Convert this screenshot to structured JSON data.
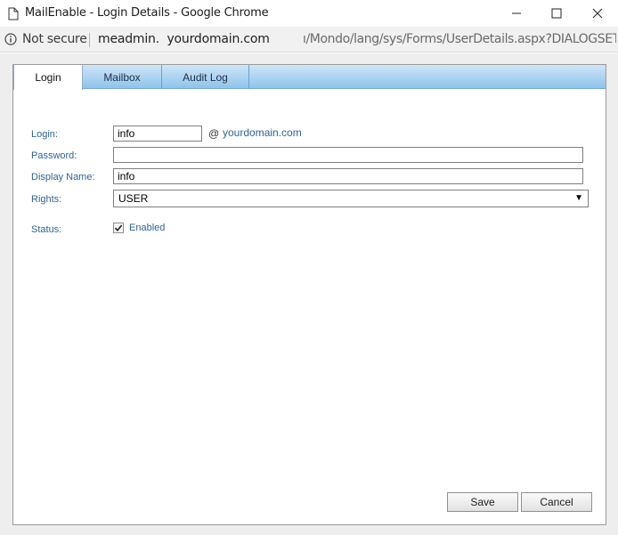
{
  "window": {
    "title": "MailEnable - Login Details - Google Chrome"
  },
  "address_bar": {
    "security_text": "Not secure",
    "host": "meadmin.  yourdomain.com",
    "path": "ı/Mondo/lang/sys/Forms/UserDetails.aspx?DIALOGSET..."
  },
  "tabs": [
    {
      "label": "Login",
      "active": true
    },
    {
      "label": "Mailbox",
      "active": false
    },
    {
      "label": "Audit Log",
      "active": false
    }
  ],
  "form": {
    "login_label": "Login:",
    "login_value": "info",
    "at_sign": "@",
    "domain": "yourdomain.com",
    "password_label": "Password:",
    "password_value": "",
    "display_name_label": "Display Name:",
    "display_name_value": "info",
    "rights_label": "Rights:",
    "rights_value": "USER",
    "status_label": "Status:",
    "status_checked": true,
    "status_option_label": "Enabled"
  },
  "buttons": {
    "save_label": "Save",
    "cancel_label": "Cancel"
  },
  "icons": {
    "title": "document-icon",
    "security": "info-icon",
    "dropdown": "dropdown-arrow-icon",
    "checkbox": "checkmark-icon"
  }
}
